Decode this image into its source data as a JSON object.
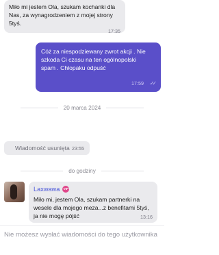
{
  "messages": [
    {
      "text": "Miło mi jestem Ola, szukam kochanki dla Nas, za wynagrodzeniem z mojej strony 5tyś.",
      "time": "17:35"
    },
    {
      "text": "Cóż za niespodziewany zwrot akcji . Nie szkoda Ci czasu na ten ogólnopolski spam . Chłopaku odpuść",
      "time": "17:59"
    }
  ],
  "date_divider": "20 marca 2024",
  "deleted_message": {
    "text": "Wiadomość usunięta",
    "time": "23:55"
  },
  "time_divider": "do godziny",
  "incoming": {
    "sender": "Laxwawa",
    "badge": "VIP",
    "text": "Miło mi, jestem Ola, szukam partnerki na wesele dla mojego meza...z benefitami 5tyś, ja nie mogę pójść",
    "time": "13:16"
  },
  "footer_notice": "Nie możesz wysłać wiadomości do tego użytkownika",
  "colors": {
    "accent": "#5a4fc9",
    "bubble_in": "#eaeaed",
    "sender": "#4b57d9",
    "vip": "#e0488b"
  },
  "icons": {
    "read_status": "double-check-icon"
  }
}
